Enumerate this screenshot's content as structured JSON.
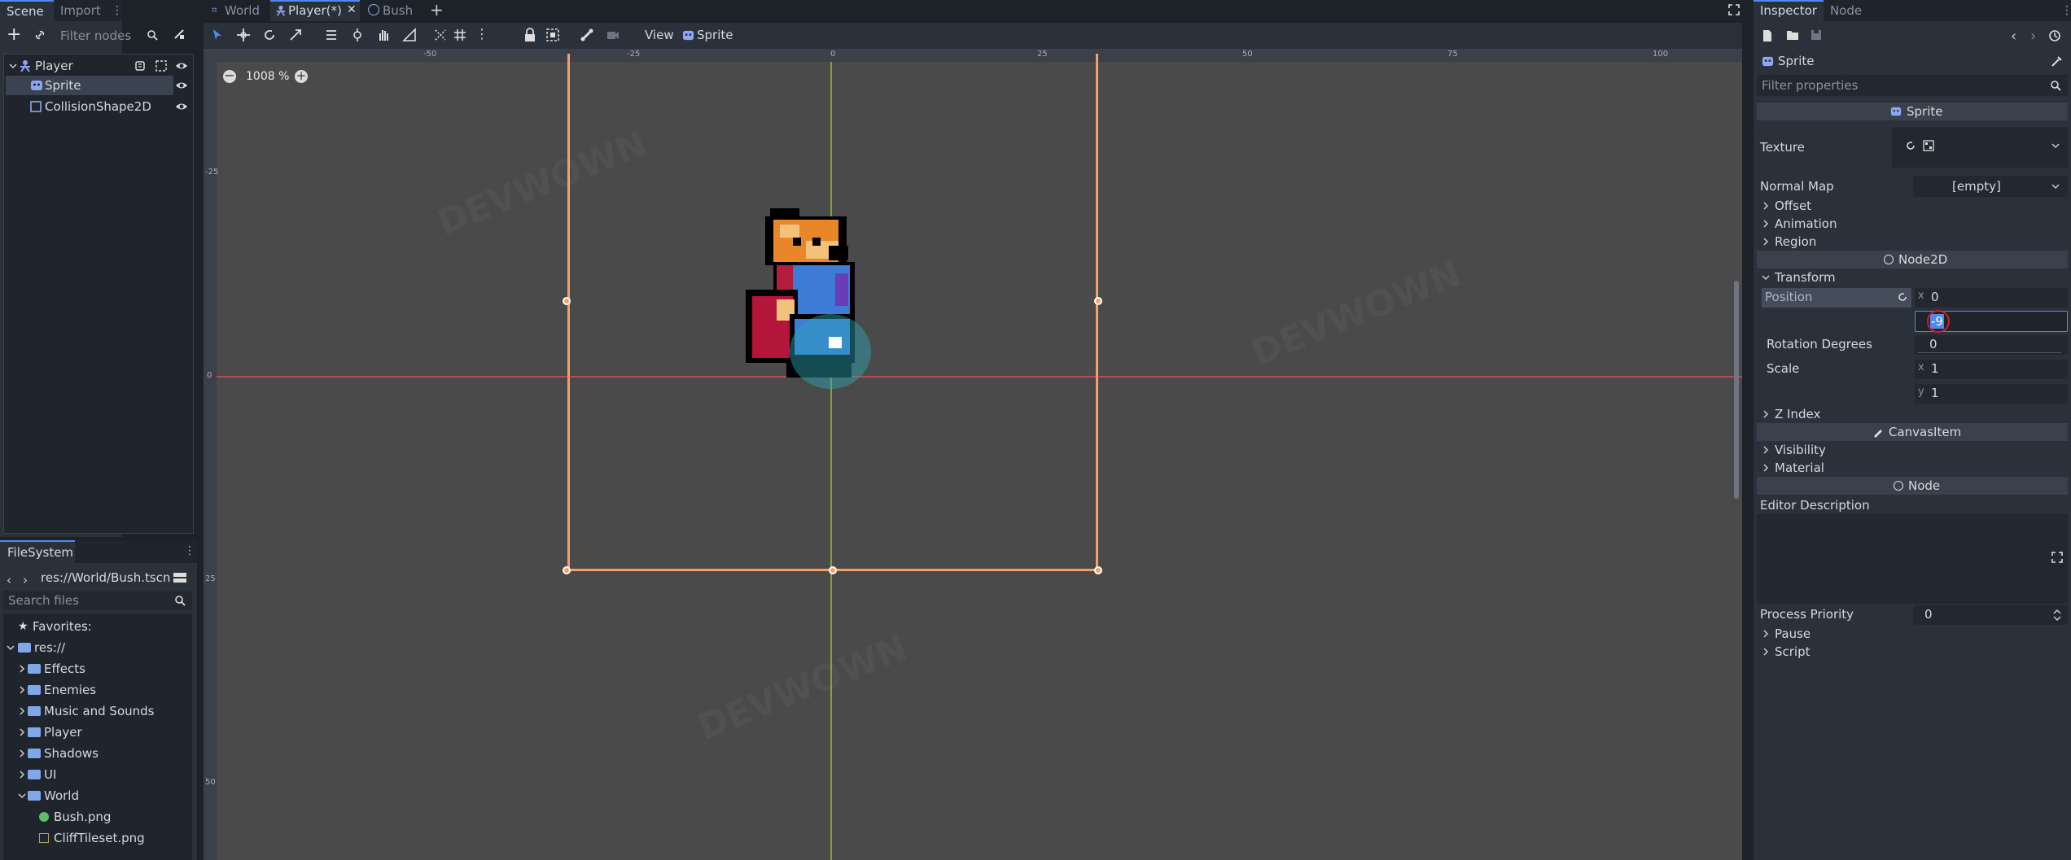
{
  "scene_dock": {
    "tabs": [
      "Scene",
      "Import"
    ],
    "filter_placeholder": "Filter nodes",
    "tree": [
      {
        "label": "Player",
        "type": "root"
      },
      {
        "label": "Sprite",
        "type": "child",
        "selected": true
      },
      {
        "label": "CollisionShape2D",
        "type": "child"
      }
    ]
  },
  "filesystem": {
    "tab": "FileSystem",
    "path": "res://World/Bush.tscn",
    "search_placeholder": "Search files",
    "favorites": "Favorites:",
    "root": "res://",
    "folders": [
      "Effects",
      "Enemies",
      "Music and Sounds",
      "Player",
      "Shadows",
      "UI",
      "World"
    ],
    "files": [
      "Bush.png",
      "CliffTileset.png"
    ]
  },
  "editor": {
    "tabs": [
      {
        "label": "World",
        "active": false
      },
      {
        "label": "Player(*)",
        "active": true
      },
      {
        "label": "Bush",
        "active": false
      }
    ],
    "toolbar_view": "View",
    "toolbar_sprite": "Sprite",
    "zoom": "1008 %",
    "ruler_top": [
      "-50",
      "-25",
      "0",
      "25",
      "50",
      "75",
      "100"
    ],
    "ruler_left": [
      "-25",
      "0",
      "25",
      "50"
    ],
    "watermark": "DEVWOWN"
  },
  "inspector": {
    "tabs": [
      "Inspector",
      "Node"
    ],
    "object": "Sprite",
    "filter_placeholder": "Filter properties",
    "class_sprite": "Sprite",
    "texture_label": "Texture",
    "normal_map_label": "Normal Map",
    "normal_map_value": "[empty]",
    "offset": "Offset",
    "animation": "Animation",
    "region": "Region",
    "class_node2d": "Node2D",
    "transform": "Transform",
    "position_label": "Position",
    "position_x": "0",
    "position_y": "-9",
    "rotation_label": "Rotation Degrees",
    "rotation_value": "0",
    "scale_label": "Scale",
    "scale_x": "1",
    "scale_y": "1",
    "z_index": "Z Index",
    "class_canvasitem": "CanvasItem",
    "visibility": "Visibility",
    "material": "Material",
    "class_node": "Node",
    "editor_description": "Editor Description",
    "process_priority_label": "Process Priority",
    "process_priority_value": "0",
    "pause": "Pause",
    "script": "Script",
    "axis_x": "x",
    "axis_y": "y"
  },
  "colors": {
    "accent": "#4c8cf0",
    "selection_box": "#f5a06a",
    "axis_x": "#c94a5c",
    "axis_y": "#9fbc3b",
    "panel": "#2b313a"
  }
}
